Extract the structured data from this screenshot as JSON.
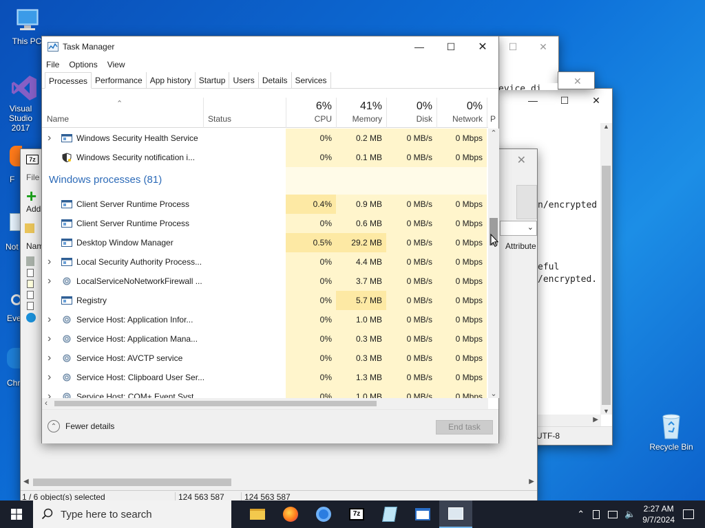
{
  "desktop": {
    "icons": [
      {
        "label": "This PC"
      },
      {
        "label": "Visual Studio 2017"
      },
      {
        "label": "Recycle Bin"
      }
    ],
    "partial_labels": [
      "F",
      "Not",
      "Eve",
      "Chr"
    ]
  },
  "task_manager": {
    "title": "Task Manager",
    "menu": [
      "File",
      "Options",
      "View"
    ],
    "tabs": [
      "Processes",
      "Performance",
      "App history",
      "Startup",
      "Users",
      "Details",
      "Services"
    ],
    "active_tab": "Processes",
    "columns": {
      "name": "Name",
      "status": "Status",
      "cpu": {
        "pct": "6%",
        "label": "CPU"
      },
      "memory": {
        "pct": "41%",
        "label": "Memory"
      },
      "disk": {
        "pct": "0%",
        "label": "Disk"
      },
      "network": {
        "pct": "0%",
        "label": "Network"
      },
      "power": "P"
    },
    "rows": [
      {
        "name": "Windows Security Health Service",
        "cpu": "0%",
        "mem": "0.2 MB",
        "disk": "0 MB/s",
        "net": "0 Mbps",
        "expand": true,
        "icon": "service-icon"
      },
      {
        "name": "Windows Security notification i...",
        "cpu": "0%",
        "mem": "0.1 MB",
        "disk": "0 MB/s",
        "net": "0 Mbps",
        "expand": false,
        "icon": "shield-icon"
      }
    ],
    "group_title": "Windows processes (81)",
    "windows_rows": [
      {
        "name": "Client Server Runtime Process",
        "cpu": "0.4%",
        "mem": "0.9 MB",
        "disk": "0 MB/s",
        "net": "0 Mbps",
        "expand": false,
        "icon": "window-icon"
      },
      {
        "name": "Client Server Runtime Process",
        "cpu": "0%",
        "mem": "0.6 MB",
        "disk": "0 MB/s",
        "net": "0 Mbps",
        "expand": false,
        "icon": "window-icon"
      },
      {
        "name": "Desktop Window Manager",
        "cpu": "0.5%",
        "mem": "29.2 MB",
        "disk": "0 MB/s",
        "net": "0 Mbps",
        "expand": false,
        "icon": "window-icon"
      },
      {
        "name": "Local Security Authority Process...",
        "cpu": "0%",
        "mem": "4.4 MB",
        "disk": "0 MB/s",
        "net": "0 Mbps",
        "expand": true,
        "icon": "window-icon"
      },
      {
        "name": "LocalServiceNoNetworkFirewall ...",
        "cpu": "0%",
        "mem": "3.7 MB",
        "disk": "0 MB/s",
        "net": "0 Mbps",
        "expand": true,
        "icon": "gear-icon"
      },
      {
        "name": "Registry",
        "cpu": "0%",
        "mem": "5.7 MB",
        "disk": "0 MB/s",
        "net": "0 Mbps",
        "expand": false,
        "icon": "window-icon"
      },
      {
        "name": "Service Host: Application Infor...",
        "cpu": "0%",
        "mem": "1.0 MB",
        "disk": "0 MB/s",
        "net": "0 Mbps",
        "expand": true,
        "icon": "gear-icon"
      },
      {
        "name": "Service Host: Application Mana...",
        "cpu": "0%",
        "mem": "0.3 MB",
        "disk": "0 MB/s",
        "net": "0 Mbps",
        "expand": true,
        "icon": "gear-icon"
      },
      {
        "name": "Service Host: AVCTP service",
        "cpu": "0%",
        "mem": "0.3 MB",
        "disk": "0 MB/s",
        "net": "0 Mbps",
        "expand": true,
        "icon": "gear-icon"
      },
      {
        "name": "Service Host: Clipboard User Ser...",
        "cpu": "0%",
        "mem": "1.3 MB",
        "disk": "0 MB/s",
        "net": "0 Mbps",
        "expand": true,
        "icon": "gear-icon"
      },
      {
        "name": "Service Host: COM+ Event Syst...",
        "cpu": "0%",
        "mem": "1.0 MB",
        "disk": "0 MB/s",
        "net": "0 Mbps",
        "expand": true,
        "icon": "gear-icon"
      }
    ],
    "fewer_details": "Fewer details",
    "end_task": "End task"
  },
  "seven_zip": {
    "menu_file": "File",
    "add_label": "Add",
    "column_name": "Nam",
    "attributes_label": "Attribute",
    "status_selected": "1 / 6 object(s) selected",
    "status_size1": "124 563 587",
    "status_size2": "124 563 587"
  },
  "notepad": {
    "lines": [
      "evice di",
      "n/encrypted",
      "eful",
      "/encrypted."
    ],
    "encoding": "UTF-8"
  },
  "taskbar": {
    "search_placeholder": "Type here to search",
    "time": "2:27 AM",
    "date": "9/7/2024"
  }
}
